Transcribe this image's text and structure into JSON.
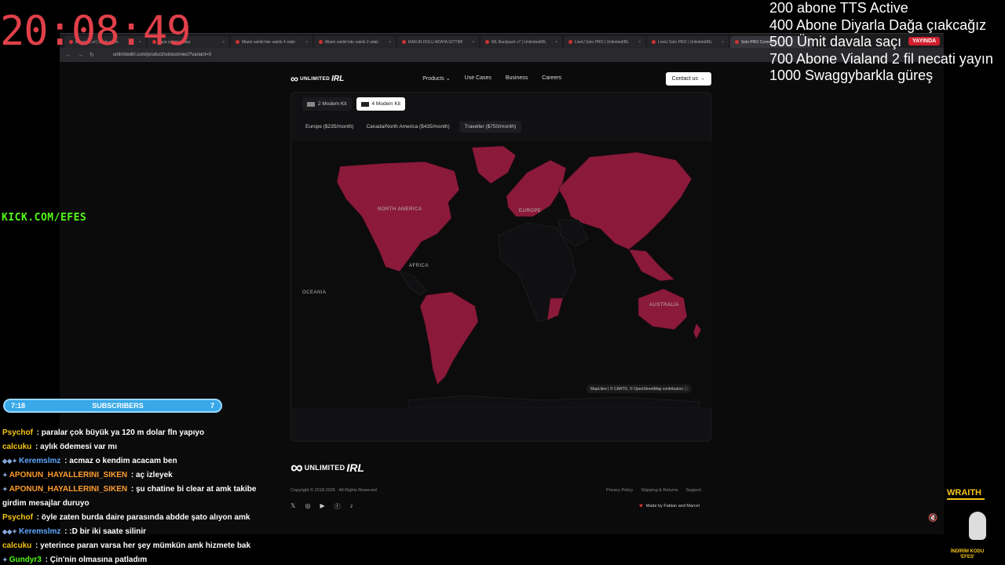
{
  "overlay": {
    "clock": "20:08:49",
    "goals": [
      "200 abone TTS Active",
      "400 Abone Diyarla Dağa çıakcağız",
      "500 Ümit davala saçı",
      "700 Abone Vialand 2 fil necati yayın",
      "1000 Swaggybarkla güreş"
    ],
    "live_badge": "YAYINDA",
    "kick_handle": "KICK.COM/EFES",
    "subscribers": {
      "left": "7:18",
      "label": "SUBSCRIBERS",
      "right": "7"
    },
    "chat": [
      {
        "user": "Psychof",
        "user_color": "#f5c518",
        "text": "paralar çok büyük ya 120 m dolar fln yapıyo",
        "badges": ""
      },
      {
        "user": "calcuku",
        "user_color": "#f5c518",
        "text": "aylık ödemesi var mı",
        "badges": ""
      },
      {
        "user": "Keremslmz",
        "user_color": "#5da9ff",
        "text": "acmaz o kendim acacam ben",
        "badges": "◆◆✦"
      },
      {
        "user": "APONUN_HAYALLERINI_SIKEN",
        "user_color": "#ff9d2e",
        "text": "aç izleyek",
        "badges": "✦"
      },
      {
        "user": "APONUN_HAYALLERINI_SIKEN",
        "user_color": "#ff9d2e",
        "text": "şu chatine bi clear at amk takibe girdim mesajlar duruyo",
        "badges": "✦"
      },
      {
        "user": "Psychof",
        "user_color": "#f5c518",
        "text": "öyle zaten burda daire parasında abdde şato alıyon amk",
        "badges": ""
      },
      {
        "user": "Keremslmz",
        "user_color": "#5da9ff",
        "text": ":D bir iki saate silinir",
        "badges": "◆◆✦"
      },
      {
        "user": "calcuku",
        "user_color": "#f5c518",
        "text": "yeterince paran varsa her şey mümkün amk hizmete bak",
        "badges": ""
      },
      {
        "user": "Gundyr3",
        "user_color": "#53fc18",
        "text": "Çin'nin olmasına patladım",
        "badges": "✦"
      }
    ],
    "sponsor_name": "WRAITH",
    "sponsor_code": "İNDİRİM KODU 'EFES'"
  },
  "browser": {
    "tabs": [
      {
        "title": "Mevcut ...el | Canlı yayın",
        "active": false
      },
      {
        "title": "Taza satılık villalar",
        "active": false
      },
      {
        "title": "Miami satılık'nde satılık 4 odalı",
        "active": false
      },
      {
        "title": "Miami satılık'nde satılık 2 odalı",
        "active": false
      },
      {
        "title": "RAKUN DOLU ADAYA GITTIM!",
        "active": false
      },
      {
        "title": "IRL Backpack v7 | UnlimitedIRL",
        "active": false
      },
      {
        "title": "LiveU Solo PRO | UnlimitedIRL",
        "active": false
      },
      {
        "title": "LiveU Solo PRO | UnlimitedIRL",
        "active": false
      },
      {
        "title": "Solo PRO Connect",
        "active": true
      }
    ],
    "url": "unlimitedirl.com/product/soloconnect?variant=0"
  },
  "site": {
    "logo_unlimited": "UNLIMITED",
    "logo_irl": "IRL",
    "menu": [
      "Products",
      "Use Cases",
      "Business",
      "Careers"
    ],
    "contact": "Contact us →",
    "kits": [
      {
        "label": "2 Modem Kit",
        "selected": false
      },
      {
        "label": "4 Modem Kit",
        "selected": true
      }
    ],
    "regions": [
      {
        "label": "Europe ($235/month)",
        "selected": false
      },
      {
        "label": "Canada/North America ($435/month)",
        "selected": false
      },
      {
        "label": "Traveller ($750/month)",
        "selected": true
      }
    ],
    "map_labels": {
      "north_america": "NORTH AMERICA",
      "europe": "EUROPE",
      "africa": "AFRICA",
      "oceania": "OCEANIA",
      "australia": "AUSTRALIA"
    },
    "map_attribution": "MapLibre | © CARTO, © OpenStreetMap contributors",
    "coverage_color": "#8b1a3a",
    "land_color": "#101012",
    "copyright": "Copyright © 2018-2025 · All Rights Reserved",
    "social": [
      "𝕏",
      "◎",
      "▶",
      "ⓕ",
      "♪"
    ],
    "footer_links": [
      "Privacy Policy",
      "Shipping & Returns",
      "Support"
    ],
    "made_by": "Made by Fabian and Marcel"
  }
}
